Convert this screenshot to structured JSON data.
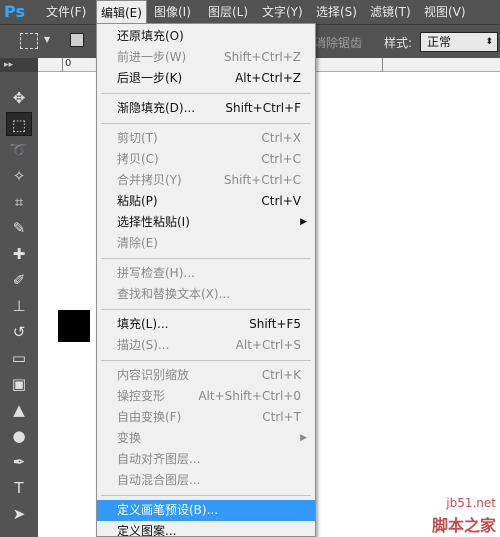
{
  "app": {
    "logo": "Ps"
  },
  "menubar": [
    {
      "label": "文件(F)"
    },
    {
      "label": "编辑(E)",
      "active": true
    },
    {
      "label": "图像(I)"
    },
    {
      "label": "图层(L)"
    },
    {
      "label": "文字(Y)"
    },
    {
      "label": "选择(S)"
    },
    {
      "label": "滤镜(T)"
    },
    {
      "label": "视图(V)"
    }
  ],
  "options": {
    "antialias": "消除锯齿",
    "style_label": "样式:",
    "style_value": "正常"
  },
  "ruler": {
    "ticks": [
      "0",
      "",
      "",
      "",
      ""
    ]
  },
  "toolbox": {
    "head": "▸▸",
    "tools": [
      "move-icon",
      "marquee-icon",
      "lasso-icon",
      "magic-wand-icon",
      "crop-icon",
      "eyedropper-icon",
      "healing-brush-icon",
      "brush-icon",
      "clone-stamp-icon",
      "history-brush-icon",
      "eraser-icon",
      "gradient-icon",
      "blur-icon",
      "dodge-icon",
      "pen-icon",
      "type-icon",
      "path-select-icon"
    ]
  },
  "edit_menu": {
    "items": [
      {
        "label": "还原填充(O)",
        "shortcut": "",
        "enabled": true
      },
      {
        "label": "前进一步(W)",
        "shortcut": "Shift+Ctrl+Z",
        "enabled": false
      },
      {
        "label": "后退一步(K)",
        "shortcut": "Alt+Ctrl+Z",
        "enabled": true
      },
      {
        "sep": true
      },
      {
        "label": "渐隐填充(D)...",
        "shortcut": "Shift+Ctrl+F",
        "enabled": true
      },
      {
        "sep": true
      },
      {
        "label": "剪切(T)",
        "shortcut": "Ctrl+X",
        "enabled": false
      },
      {
        "label": "拷贝(C)",
        "shortcut": "Ctrl+C",
        "enabled": false
      },
      {
        "label": "合并拷贝(Y)",
        "shortcut": "Shift+Ctrl+C",
        "enabled": false
      },
      {
        "label": "粘贴(P)",
        "shortcut": "Ctrl+V",
        "enabled": true
      },
      {
        "label": "选择性粘贴(I)",
        "shortcut": "",
        "enabled": true,
        "submenu": true
      },
      {
        "label": "清除(E)",
        "shortcut": "",
        "enabled": false
      },
      {
        "sep": true
      },
      {
        "label": "拼写检查(H)...",
        "shortcut": "",
        "enabled": false
      },
      {
        "label": "查找和替换文本(X)...",
        "shortcut": "",
        "enabled": false
      },
      {
        "sep": true
      },
      {
        "label": "填充(L)...",
        "shortcut": "Shift+F5",
        "enabled": true
      },
      {
        "label": "描边(S)...",
        "shortcut": "Alt+Ctrl+S",
        "enabled": false
      },
      {
        "sep": true
      },
      {
        "label": "内容识别缩放",
        "shortcut": "Ctrl+K",
        "enabled": false
      },
      {
        "label": "操控变形",
        "shortcut": "Alt+Shift+Ctrl+0",
        "enabled": false
      },
      {
        "label": "自由变换(F)",
        "shortcut": "Ctrl+T",
        "enabled": false
      },
      {
        "label": "变换",
        "shortcut": "",
        "enabled": false,
        "submenu": true
      },
      {
        "label": "自动对齐图层...",
        "shortcut": "",
        "enabled": false
      },
      {
        "label": "自动混合图层...",
        "shortcut": "",
        "enabled": false
      },
      {
        "sep": true
      },
      {
        "label": "定义画笔预设(B)...",
        "shortcut": "",
        "enabled": true,
        "highlighted": true
      },
      {
        "label": "定义图案...",
        "shortcut": "",
        "enabled": true
      }
    ]
  },
  "watermark": {
    "line1": "jb51.net",
    "line2": "脚本之家"
  },
  "colors": {
    "chrome": "#535353",
    "menu_bg": "#f0f0f0",
    "highlight": "#3399ff",
    "disabled": "#8a8a8a"
  }
}
